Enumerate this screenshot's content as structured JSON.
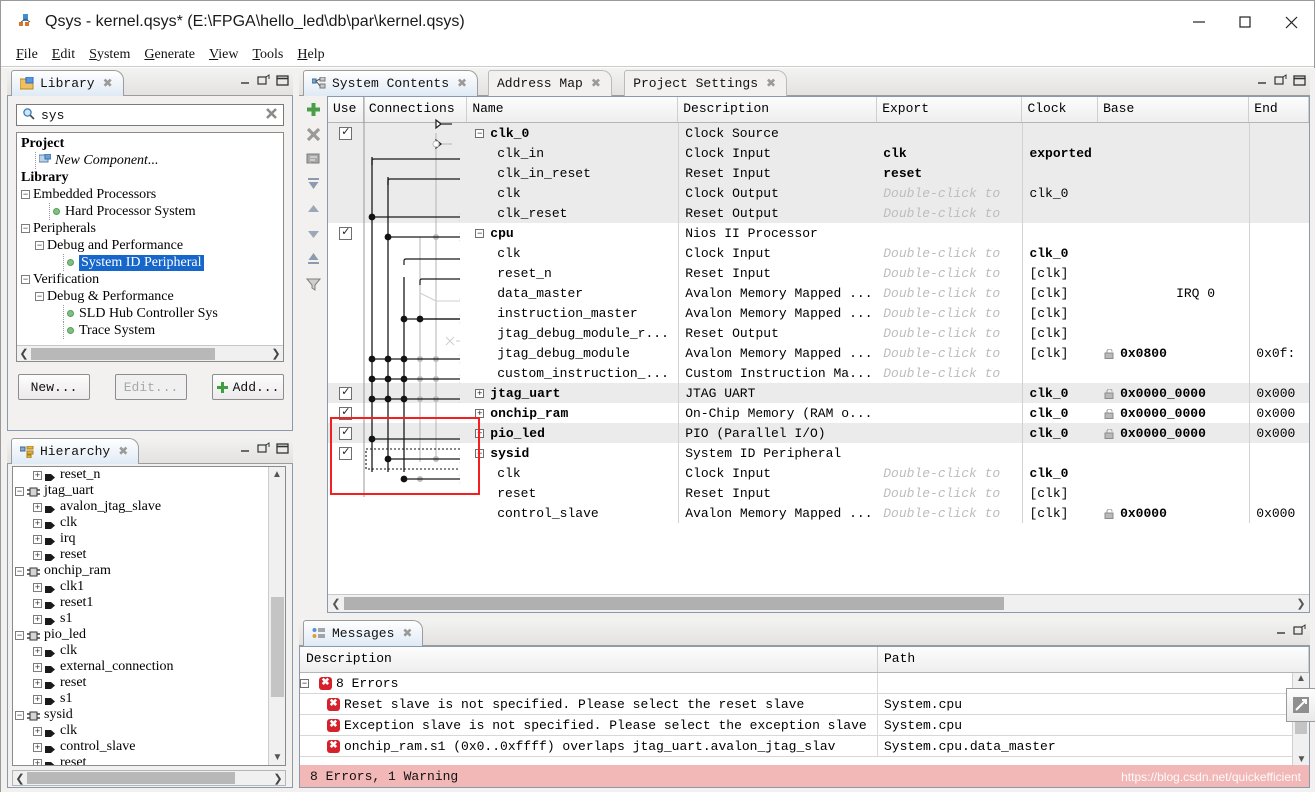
{
  "window": {
    "title": "Qsys - kernel.qsys* (E:\\FPGA\\hello_led\\db\\par\\kernel.qsys)",
    "app_icon": "qsys-icon",
    "minimize_label": "—",
    "maximize_label": "□",
    "close_label": "✕"
  },
  "menubar": {
    "items": [
      {
        "label": "File",
        "mnemonic": "F"
      },
      {
        "label": "Edit",
        "mnemonic": "E"
      },
      {
        "label": "System",
        "mnemonic": "S"
      },
      {
        "label": "Generate",
        "mnemonic": "G"
      },
      {
        "label": "View",
        "mnemonic": "V"
      },
      {
        "label": "Tools",
        "mnemonic": "T"
      },
      {
        "label": "Help",
        "mnemonic": "H"
      }
    ]
  },
  "library": {
    "tab_label": "Library",
    "tab_icon": "library-folder-icon",
    "search": {
      "value": "sys",
      "placeholder": "Search",
      "icon": "search-icon",
      "clear_icon": "clear-icon"
    },
    "tree": [
      {
        "label": "Project",
        "indent": 0,
        "style": "bold",
        "icon": "none"
      },
      {
        "label": "New Component...",
        "indent": 1,
        "style": "italic",
        "icon": "component-icon"
      },
      {
        "label": "Library",
        "indent": 0,
        "style": "bold",
        "icon": "none"
      },
      {
        "label": "Embedded Processors",
        "indent": 0,
        "style": "normal",
        "icon": "expander-minus"
      },
      {
        "label": "Hard Processor System",
        "indent": 2,
        "style": "normal",
        "icon": "green-dot"
      },
      {
        "label": "Peripherals",
        "indent": 0,
        "style": "normal",
        "icon": "expander-minus"
      },
      {
        "label": "Debug and Performance",
        "indent": 1,
        "style": "normal",
        "icon": "expander-minus"
      },
      {
        "label": "System ID Peripheral",
        "indent": 3,
        "style": "selected",
        "icon": "green-dot"
      },
      {
        "label": "Verification",
        "indent": 0,
        "style": "normal",
        "icon": "expander-minus"
      },
      {
        "label": "Debug & Performance",
        "indent": 1,
        "style": "normal",
        "icon": "expander-minus"
      },
      {
        "label": "SLD Hub Controller Sys",
        "indent": 3,
        "style": "normal",
        "icon": "green-dot"
      },
      {
        "label": "Trace System",
        "indent": 3,
        "style": "normal",
        "icon": "green-dot"
      }
    ],
    "buttons": {
      "new": "New...",
      "edit": "Edit...",
      "add": "Add..."
    }
  },
  "hierarchy": {
    "tab_label": "Hierarchy",
    "tab_icon": "hierarchy-icon",
    "rows": [
      {
        "label": "reset_n",
        "indent": 1,
        "icon": "port-icon",
        "expander": "plus"
      },
      {
        "label": "jtag_uart",
        "indent": 0,
        "icon": "module-icon",
        "expander": "minus"
      },
      {
        "label": "avalon_jtag_slave",
        "indent": 1,
        "icon": "port-icon",
        "expander": "plus"
      },
      {
        "label": "clk",
        "indent": 1,
        "icon": "port-icon",
        "expander": "plus"
      },
      {
        "label": "irq",
        "indent": 1,
        "icon": "port-icon",
        "expander": "plus"
      },
      {
        "label": "reset",
        "indent": 1,
        "icon": "port-icon",
        "expander": "plus"
      },
      {
        "label": "onchip_ram",
        "indent": 0,
        "icon": "module-icon",
        "expander": "minus"
      },
      {
        "label": "clk1",
        "indent": 1,
        "icon": "port-icon",
        "expander": "plus"
      },
      {
        "label": "reset1",
        "indent": 1,
        "icon": "port-icon",
        "expander": "plus"
      },
      {
        "label": "s1",
        "indent": 1,
        "icon": "port-icon",
        "expander": "plus"
      },
      {
        "label": "pio_led",
        "indent": 0,
        "icon": "module-icon",
        "expander": "minus"
      },
      {
        "label": "clk",
        "indent": 1,
        "icon": "port-icon",
        "expander": "plus"
      },
      {
        "label": "external_connection",
        "indent": 1,
        "icon": "port-icon",
        "expander": "plus"
      },
      {
        "label": "reset",
        "indent": 1,
        "icon": "port-icon",
        "expander": "plus"
      },
      {
        "label": "s1",
        "indent": 1,
        "icon": "port-icon",
        "expander": "plus"
      },
      {
        "label": "sysid",
        "indent": 0,
        "icon": "module-icon",
        "expander": "minus"
      },
      {
        "label": "clk",
        "indent": 1,
        "icon": "port-icon",
        "expander": "plus"
      },
      {
        "label": "control_slave",
        "indent": 1,
        "icon": "port-icon",
        "expander": "plus"
      },
      {
        "label": "reset",
        "indent": 1,
        "icon": "port-icon",
        "expander": "plus"
      }
    ]
  },
  "system_contents": {
    "tabs": [
      {
        "label": "System Contents",
        "active": true,
        "icon": "system-contents-icon",
        "closable": true
      },
      {
        "label": "Address Map",
        "active": false,
        "icon": "none",
        "closable": true
      },
      {
        "label": "Project Settings",
        "active": false,
        "icon": "none",
        "closable": true
      }
    ],
    "toolbar_icons": [
      "add-icon",
      "remove-icon",
      "edit-icon",
      "move-to-top-icon",
      "move-up-icon",
      "move-down-icon",
      "move-to-bottom-icon",
      "filter-icon"
    ],
    "columns": [
      "Use",
      "Connections",
      "Name",
      "Description",
      "Export",
      "Clock",
      "Base",
      "End"
    ],
    "rows": [
      {
        "use": true,
        "name": "clk_0",
        "expander": "minus",
        "level": 0,
        "desc": "Clock Source",
        "export": "",
        "clock": "",
        "base": "",
        "end": "",
        "shade": true,
        "bold": true
      },
      {
        "use": null,
        "name": "clk_in",
        "expander": "none",
        "level": 1,
        "desc": "Clock Input",
        "export": "clk",
        "clock": "exported",
        "base": "",
        "end": "",
        "shade": true,
        "bold": false,
        "export_bold": true,
        "clock_bold": true
      },
      {
        "use": null,
        "name": "clk_in_reset",
        "expander": "none",
        "level": 1,
        "desc": "Reset Input",
        "export": "reset",
        "clock": "",
        "base": "",
        "end": "",
        "shade": true,
        "bold": false,
        "export_bold": true
      },
      {
        "use": null,
        "name": "clk",
        "expander": "none",
        "level": 1,
        "desc": "Clock Output",
        "export": "Double-click to",
        "clock": "clk_0",
        "base": "",
        "end": "",
        "shade": true,
        "bold": false,
        "export_ghost": true
      },
      {
        "use": null,
        "name": "clk_reset",
        "expander": "none",
        "level": 1,
        "desc": "Reset Output",
        "export": "Double-click to",
        "clock": "",
        "base": "",
        "end": "",
        "shade": true,
        "bold": false,
        "export_ghost": true
      },
      {
        "use": true,
        "name": "cpu",
        "expander": "minus",
        "level": 0,
        "desc": "Nios II Processor",
        "export": "",
        "clock": "",
        "base": "",
        "end": "",
        "shade": false,
        "bold": true
      },
      {
        "use": null,
        "name": "clk",
        "expander": "none",
        "level": 1,
        "desc": "Clock Input",
        "export": "Double-click to",
        "clock": "clk_0",
        "base": "",
        "end": "",
        "shade": false,
        "bold": false,
        "export_ghost": true,
        "clock_bold": true
      },
      {
        "use": null,
        "name": "reset_n",
        "expander": "none",
        "level": 1,
        "desc": "Reset Input",
        "export": "Double-click to",
        "clock": "[clk]",
        "base": "",
        "end": "",
        "shade": false,
        "bold": false,
        "export_ghost": true
      },
      {
        "use": null,
        "name": "data_master",
        "expander": "none",
        "level": 1,
        "desc": "Avalon Memory Mapped ...",
        "export": "Double-click to",
        "clock": "[clk]",
        "base": "IRQ 0",
        "end": "",
        "shade": false,
        "bold": false,
        "export_ghost": true,
        "base_irq": true
      },
      {
        "use": null,
        "name": "instruction_master",
        "expander": "none",
        "level": 1,
        "desc": "Avalon Memory Mapped ...",
        "export": "Double-click to",
        "clock": "[clk]",
        "base": "",
        "end": "",
        "shade": false,
        "bold": false,
        "export_ghost": true
      },
      {
        "use": null,
        "name": "jtag_debug_module_r...",
        "expander": "none",
        "level": 1,
        "desc": "Reset Output",
        "export": "Double-click to",
        "clock": "[clk]",
        "base": "",
        "end": "",
        "shade": false,
        "bold": false,
        "export_ghost": true
      },
      {
        "use": null,
        "name": "jtag_debug_module",
        "expander": "none",
        "level": 1,
        "desc": "Avalon Memory Mapped ...",
        "export": "Double-click to",
        "clock": "[clk]",
        "base": "0x0800",
        "end": "0x0f:",
        "shade": false,
        "bold": false,
        "export_ghost": true,
        "lock": true,
        "base_bold": true
      },
      {
        "use": null,
        "name": "custom_instruction_...",
        "expander": "none",
        "level": 1,
        "desc": "Custom Instruction Ma...",
        "export": "Double-click to",
        "clock": "",
        "base": "",
        "end": "",
        "shade": false,
        "bold": false,
        "export_ghost": true
      },
      {
        "use": true,
        "name": "jtag_uart",
        "expander": "plus",
        "level": 0,
        "desc": "JTAG UART",
        "export": "",
        "clock": "clk_0",
        "base": "0x0000_0000",
        "end": "0x000",
        "shade": true,
        "bold": true,
        "clock_bold": true,
        "lock": true,
        "base_bold": true
      },
      {
        "use": true,
        "name": "onchip_ram",
        "expander": "plus",
        "level": 0,
        "desc": "On-Chip Memory (RAM o...",
        "export": "",
        "clock": "clk_0",
        "base": "0x0000_0000",
        "end": "0x000",
        "shade": false,
        "bold": true,
        "clock_bold": true,
        "lock": true,
        "base_bold": true
      },
      {
        "use": true,
        "name": "pio_led",
        "expander": "plus",
        "level": 0,
        "desc": "PIO (Parallel I/O)",
        "export": "",
        "clock": "clk_0",
        "base": "0x0000_0000",
        "end": "0x000",
        "shade": true,
        "bold": true,
        "clock_bold": true,
        "lock": true,
        "base_bold": true
      },
      {
        "use": true,
        "name": "sysid",
        "expander": "minus",
        "level": 0,
        "desc": "System ID Peripheral",
        "export": "",
        "clock": "",
        "base": "",
        "end": "",
        "shade": false,
        "bold": true
      },
      {
        "use": null,
        "name": "clk",
        "expander": "none",
        "level": 1,
        "desc": "Clock Input",
        "export": "Double-click to",
        "clock": "clk_0",
        "base": "",
        "end": "",
        "shade": false,
        "bold": false,
        "export_ghost": true,
        "clock_bold": true
      },
      {
        "use": null,
        "name": "reset",
        "expander": "none",
        "level": 1,
        "desc": "Reset Input",
        "export": "Double-click to",
        "clock": "[clk]",
        "base": "",
        "end": "",
        "shade": false,
        "bold": false,
        "export_ghost": true
      },
      {
        "use": null,
        "name": "control_slave",
        "expander": "none",
        "level": 1,
        "desc": "Avalon Memory Mapped ...",
        "export": "Double-click to",
        "clock": "[clk]",
        "base": "0x0000",
        "end": "0x000",
        "shade": false,
        "bold": false,
        "export_ghost": true,
        "lock": true,
        "base_bold": true
      }
    ],
    "highlight": {
      "color": "#f42020",
      "note": "sysid connection rows highlighted"
    }
  },
  "messages": {
    "tab_label": "Messages",
    "tab_icon": "messages-icon",
    "columns": [
      "Description",
      "Path"
    ],
    "rows": [
      {
        "icon": "error-group-icon",
        "expander": "minus",
        "level": 0,
        "desc": "8 Errors",
        "path": ""
      },
      {
        "icon": "error-icon",
        "expander": "none",
        "level": 1,
        "desc": "Reset slave is not specified. Please select the reset slave",
        "path": "System.cpu"
      },
      {
        "icon": "error-icon",
        "expander": "none",
        "level": 1,
        "desc": "Exception slave is not specified. Please select the exception slave",
        "path": "System.cpu"
      },
      {
        "icon": "error-icon",
        "expander": "none",
        "level": 1,
        "desc": "onchip_ram.s1 (0x0..0xffff) overlaps jtag_uart.avalon_jtag_slav",
        "path": "System.cpu.data_master",
        "bold_parts": true
      }
    ],
    "status": "8 Errors, 1 Warning",
    "status_color": "#f2b7b7"
  },
  "watermark": "https://blog.csdn.net/quickefficient",
  "panel_controls": {
    "minimize": "minimize-icon",
    "restore": "restore-icon",
    "maximize": "maximize-icon"
  }
}
